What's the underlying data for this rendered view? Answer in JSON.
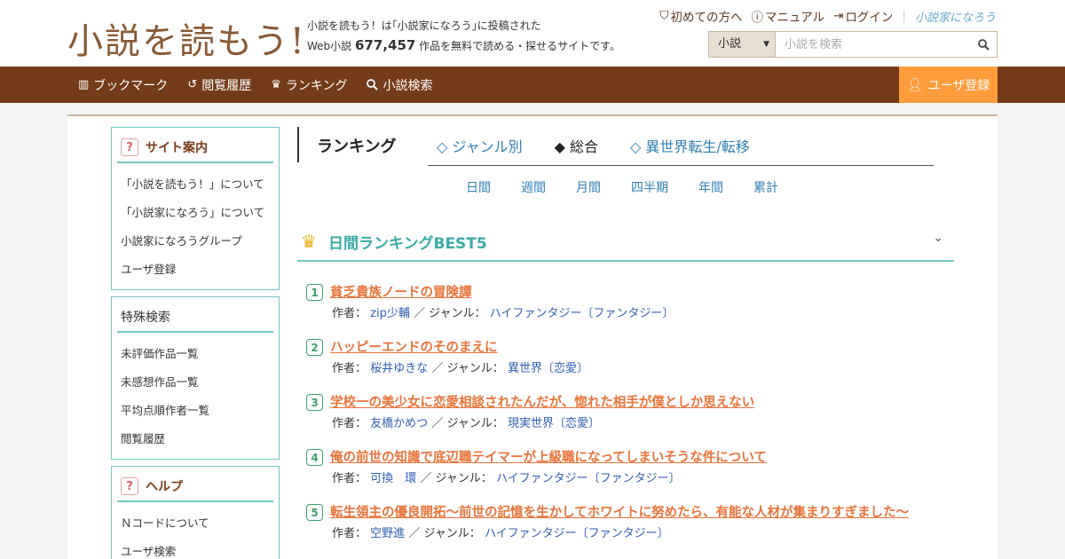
{
  "header": {
    "logo_text": "小説を読もう!",
    "tagline_line1": "小説を読もう！は｢小説家になろう｣に投稿された",
    "tagline_prefix": "Web小説",
    "tagline_count": "677,457",
    "tagline_suffix": "作品を無料で読める・探せるサイトです。",
    "links": {
      "first_time": "初めての方へ",
      "manual": "マニュアル",
      "login": "ログイン",
      "narou_logo": "小説家になろう"
    },
    "search": {
      "select_value": "小説",
      "placeholder": "小説を検索"
    }
  },
  "nav": {
    "items": [
      "ブックマーク",
      "閲覧履歴",
      "ランキング",
      "小説検索"
    ],
    "register": "ユーザ登録"
  },
  "sidebar": {
    "site_guide": {
      "title": "サイト案内",
      "items": [
        "「小説を読もう！」について",
        "「小説家になろう」について",
        "小説家になろうグループ",
        "ユーザ登録"
      ]
    },
    "special_search": {
      "title": "特殊検索",
      "items": [
        "未評価作品一覧",
        "未感想作品一覧",
        "平均点順作者一覧",
        "閲覧履歴"
      ]
    },
    "help": {
      "title": "ヘルプ",
      "items": [
        "Ｎコードについて",
        "ユーザ検索"
      ]
    }
  },
  "ranking": {
    "heading": "ランキング",
    "tabs": [
      "◇ ジャンル別",
      "◆ 総合",
      "◇ 異世界転生/転移"
    ],
    "periods": [
      "日間",
      "週間",
      "月間",
      "四半期",
      "年間",
      "累計"
    ],
    "section_title": "日間ランキングBEST5",
    "author_label": "作者：",
    "genre_label": "／ ジャンル：",
    "entries": [
      {
        "rank": "1",
        "title": "貧乏貴族ノードの冒険譚",
        "author": "zip少輔",
        "genre": "ハイファンタジー〔ファンタジー〕"
      },
      {
        "rank": "2",
        "title": "ハッピーエンドのそのまえに",
        "author": "桜井ゆきな",
        "genre": "異世界〔恋愛〕"
      },
      {
        "rank": "3",
        "title": "学校一の美少女に恋愛相談されたんだが、惚れた相手が僕としか思えない",
        "author": "友橋かめつ",
        "genre": "現実世界〔恋愛〕"
      },
      {
        "rank": "4",
        "title": "俺の前世の知識で底辺職テイマーが上級職になってしまいそうな件について",
        "author": "可換　環",
        "genre": "ハイファンタジー〔ファンタジー〕"
      },
      {
        "rank": "5",
        "title": "転生領主の優良開拓～前世の記憶を生かしてホワイトに努めたら、有能な人材が集まりすぎました～",
        "author": "空野進",
        "genre": "ハイファンタジー〔ファンタジー〕"
      }
    ]
  }
}
